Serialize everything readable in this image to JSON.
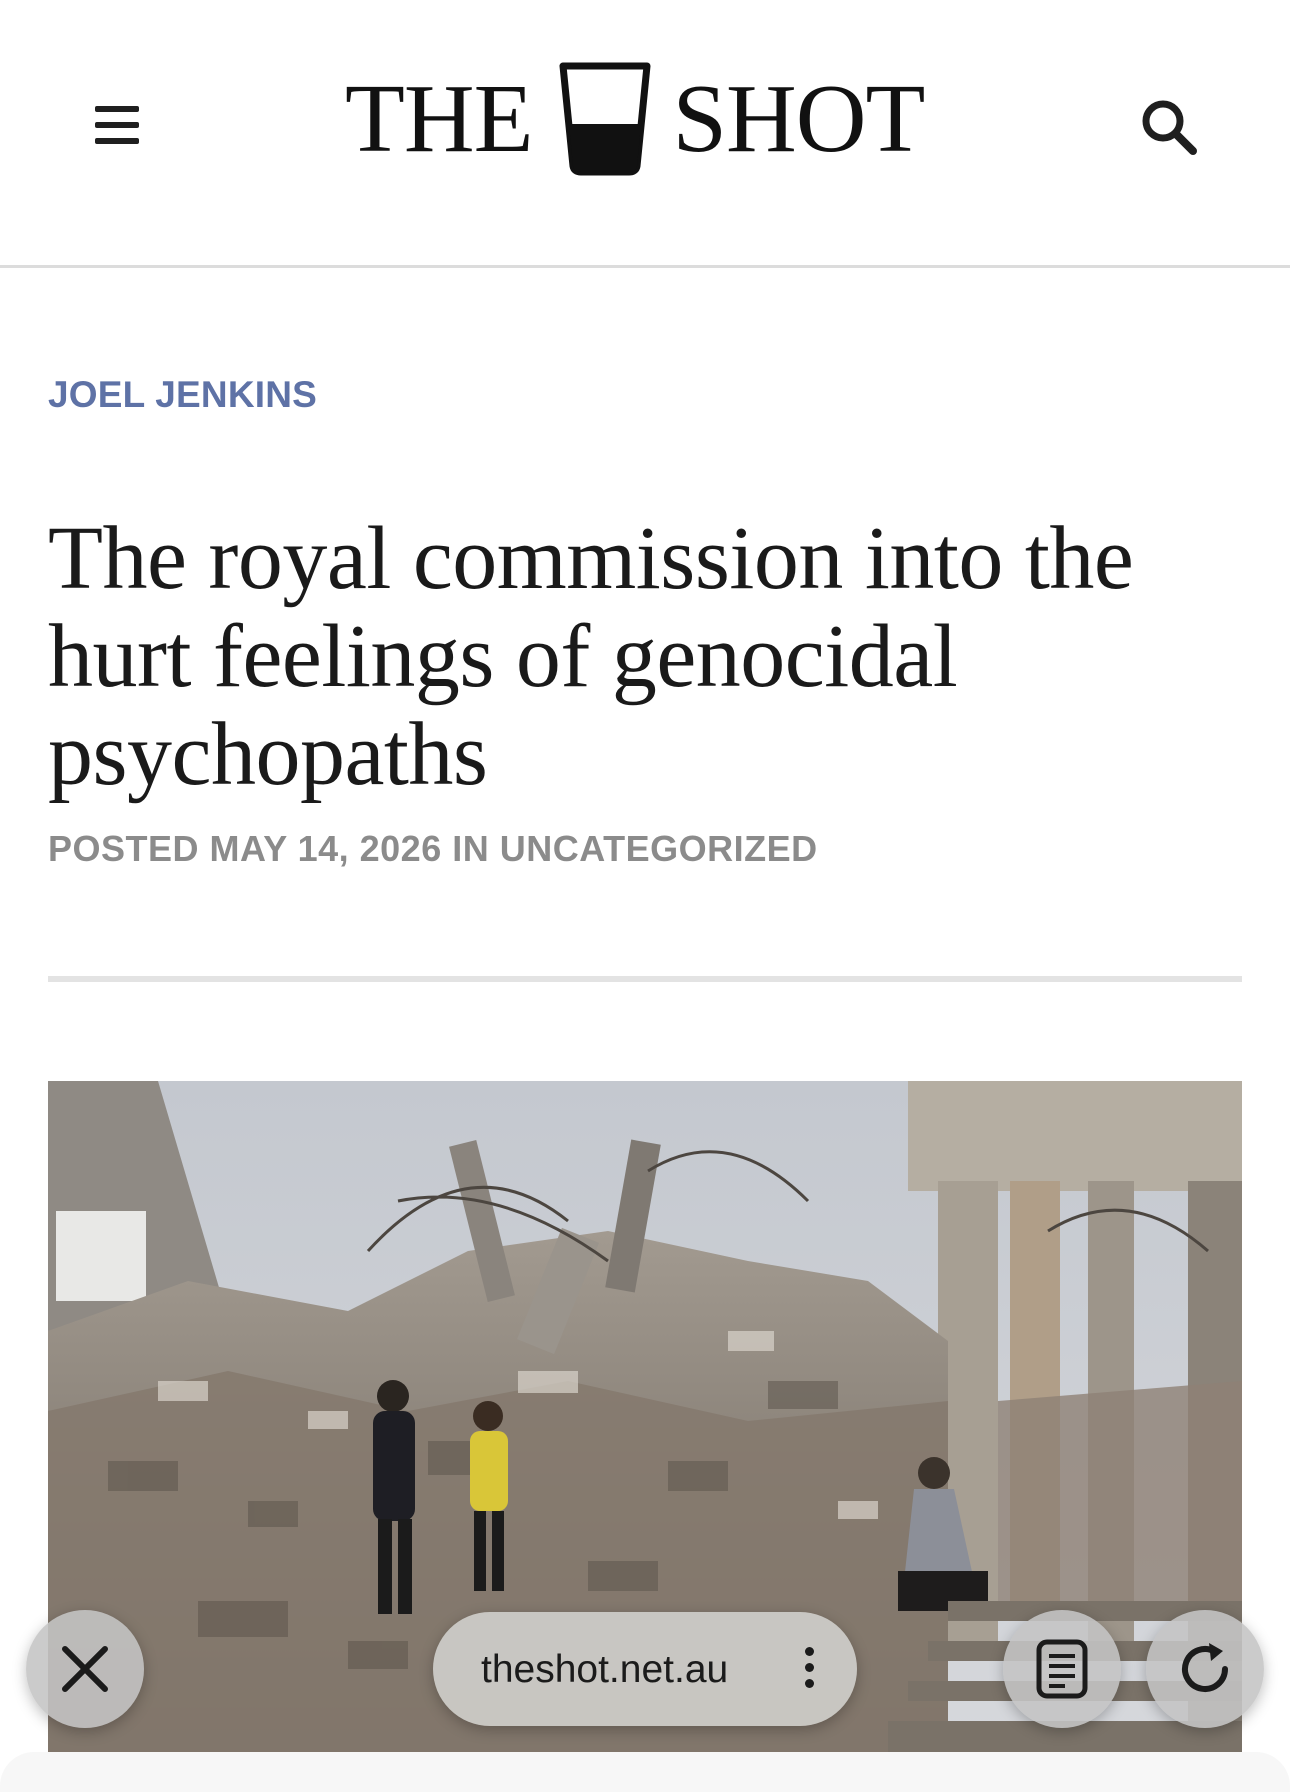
{
  "header": {
    "logo_left": "THE",
    "logo_right": "SHOT",
    "menu_icon": "hamburger-menu-icon",
    "search_icon": "search-icon"
  },
  "article": {
    "author": "JOEL JENKINS",
    "title": "The royal commission into the hurt feelings of genocidal psychopaths",
    "meta": {
      "posted_label": "POSTED",
      "date": "MAY 14, 2026",
      "in_label": "IN",
      "category": "UNCATEGORIZED"
    }
  },
  "browser": {
    "url": "theshot.net.au",
    "close_icon": "close-icon",
    "more_icon": "more-vertical-icon",
    "reader_icon": "reader-mode-icon",
    "reload_icon": "reload-icon"
  }
}
